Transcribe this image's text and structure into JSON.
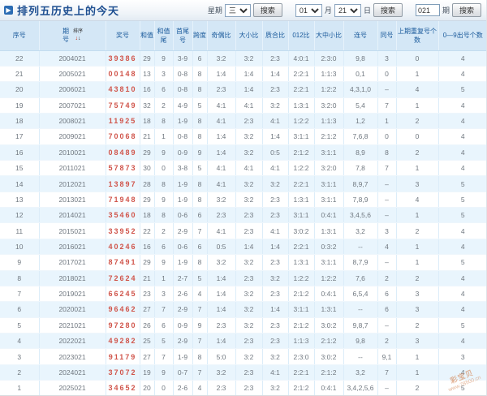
{
  "header": {
    "title": "排列五历史上的今天",
    "week_label": "星期",
    "week_value": "三",
    "month_value": "01",
    "month_label": "月",
    "day_value": "21",
    "day_label": "日",
    "issue_value": "021",
    "issue_label": "期",
    "search_label": "搜索"
  },
  "table": {
    "columns": [
      "序号",
      "期号",
      "奖号",
      "和值",
      "和值尾",
      "首尾号",
      "跨度",
      "奇偶比",
      "大小比",
      "质合比",
      "012比",
      "大中小比",
      "连号",
      "同号",
      "上期重复号个数",
      "0—9出号个数"
    ],
    "sort_label": "排序",
    "rows": [
      [
        "22",
        "2004021",
        "39386",
        "29",
        "9",
        "3-9",
        "6",
        "3:2",
        "3:2",
        "2:3",
        "4:0:1",
        "2:3:0",
        "9,8",
        "3",
        "0",
        "4"
      ],
      [
        "21",
        "2005021",
        "00148",
        "13",
        "3",
        "0-8",
        "8",
        "1:4",
        "1:4",
        "1:4",
        "2:2:1",
        "1:1:3",
        "0,1",
        "0",
        "1",
        "4"
      ],
      [
        "20",
        "2006021",
        "43810",
        "16",
        "6",
        "0-8",
        "8",
        "2:3",
        "1:4",
        "2:3",
        "2:2:1",
        "1:2:2",
        "4,3,1,0",
        "–",
        "4",
        "5"
      ],
      [
        "19",
        "2007021",
        "75749",
        "32",
        "2",
        "4-9",
        "5",
        "4:1",
        "4:1",
        "3:2",
        "1:3:1",
        "3:2:0",
        "5,4",
        "7",
        "1",
        "4"
      ],
      [
        "18",
        "2008021",
        "11925",
        "18",
        "8",
        "1-9",
        "8",
        "4:1",
        "2:3",
        "4:1",
        "1:2:2",
        "1:1:3",
        "1,2",
        "1",
        "2",
        "4"
      ],
      [
        "17",
        "2009021",
        "70068",
        "21",
        "1",
        "0-8",
        "8",
        "1:4",
        "3:2",
        "1:4",
        "3:1:1",
        "2:1:2",
        "7,6,8",
        "0",
        "0",
        "4"
      ],
      [
        "16",
        "2010021",
        "08489",
        "29",
        "9",
        "0-9",
        "9",
        "1:4",
        "3:2",
        "0:5",
        "2:1:2",
        "3:1:1",
        "8,9",
        "8",
        "2",
        "4"
      ],
      [
        "15",
        "2011021",
        "57873",
        "30",
        "0",
        "3-8",
        "5",
        "4:1",
        "4:1",
        "4:1",
        "1:2:2",
        "3:2:0",
        "7,8",
        "7",
        "1",
        "4"
      ],
      [
        "14",
        "2012021",
        "13897",
        "28",
        "8",
        "1-9",
        "8",
        "4:1",
        "3:2",
        "3:2",
        "2:2:1",
        "3:1:1",
        "8,9,7",
        "–",
        "3",
        "5"
      ],
      [
        "13",
        "2013021",
        "71948",
        "29",
        "9",
        "1-9",
        "8",
        "3:2",
        "3:2",
        "2:3",
        "1:3:1",
        "3:1:1",
        "7,8,9",
        "–",
        "4",
        "5"
      ],
      [
        "12",
        "2014021",
        "35460",
        "18",
        "8",
        "0-6",
        "6",
        "2:3",
        "2:3",
        "2:3",
        "3:1:1",
        "0:4:1",
        "3,4,5,6",
        "–",
        "1",
        "5"
      ],
      [
        "11",
        "2015021",
        "33952",
        "22",
        "2",
        "2-9",
        "7",
        "4:1",
        "2:3",
        "4:1",
        "3:0:2",
        "1:3:1",
        "3,2",
        "3",
        "2",
        "4"
      ],
      [
        "10",
        "2016021",
        "40246",
        "16",
        "6",
        "0-6",
        "6",
        "0:5",
        "1:4",
        "1:4",
        "2:2:1",
        "0:3:2",
        "--",
        "4",
        "1",
        "4"
      ],
      [
        "9",
        "2017021",
        "87491",
        "29",
        "9",
        "1-9",
        "8",
        "3:2",
        "3:2",
        "2:3",
        "1:3:1",
        "3:1:1",
        "8,7,9",
        "–",
        "1",
        "5"
      ],
      [
        "8",
        "2018021",
        "72624",
        "21",
        "1",
        "2-7",
        "5",
        "1:4",
        "2:3",
        "3:2",
        "1:2:2",
        "1:2:2",
        "7,6",
        "2",
        "2",
        "4"
      ],
      [
        "7",
        "2019021",
        "66245",
        "23",
        "3",
        "2-6",
        "4",
        "1:4",
        "3:2",
        "2:3",
        "2:1:2",
        "0:4:1",
        "6,5,4",
        "6",
        "3",
        "4"
      ],
      [
        "6",
        "2020021",
        "96462",
        "27",
        "7",
        "2-9",
        "7",
        "1:4",
        "3:2",
        "1:4",
        "3:1:1",
        "1:3:1",
        "--",
        "6",
        "3",
        "4"
      ],
      [
        "5",
        "2021021",
        "97280",
        "26",
        "6",
        "0-9",
        "9",
        "2:3",
        "3:2",
        "2:3",
        "2:1:2",
        "3:0:2",
        "9,8,7",
        "–",
        "2",
        "5"
      ],
      [
        "4",
        "2022021",
        "49282",
        "25",
        "5",
        "2-9",
        "7",
        "1:4",
        "2:3",
        "2:3",
        "1:1:3",
        "2:1:2",
        "9,8",
        "2",
        "3",
        "4"
      ],
      [
        "3",
        "2023021",
        "91179",
        "27",
        "7",
        "1-9",
        "8",
        "5:0",
        "3:2",
        "3:2",
        "2:3:0",
        "3:0:2",
        "--",
        "9,1",
        "1",
        "3"
      ],
      [
        "2",
        "2024021",
        "37072",
        "19",
        "9",
        "0-7",
        "7",
        "3:2",
        "2:3",
        "4:1",
        "2:2:1",
        "2:1:2",
        "3,2",
        "7",
        "1",
        "4"
      ],
      [
        "1",
        "2025021",
        "34652",
        "20",
        "0",
        "2-6",
        "4",
        "2:3",
        "2:3",
        "3:2",
        "2:1:2",
        "0:4:1",
        "3,4,2,5,6",
        "–",
        "2",
        "5"
      ]
    ]
  },
  "watermark": {
    "line1": "彩宝贝",
    "line2": "www.78500.cn"
  },
  "colors": {
    "accent_blue": "#1e4f91",
    "header_bg": "#d4e7f6",
    "row_alt_bg": "#e9f5fd",
    "prize_red": "#d0544a"
  }
}
